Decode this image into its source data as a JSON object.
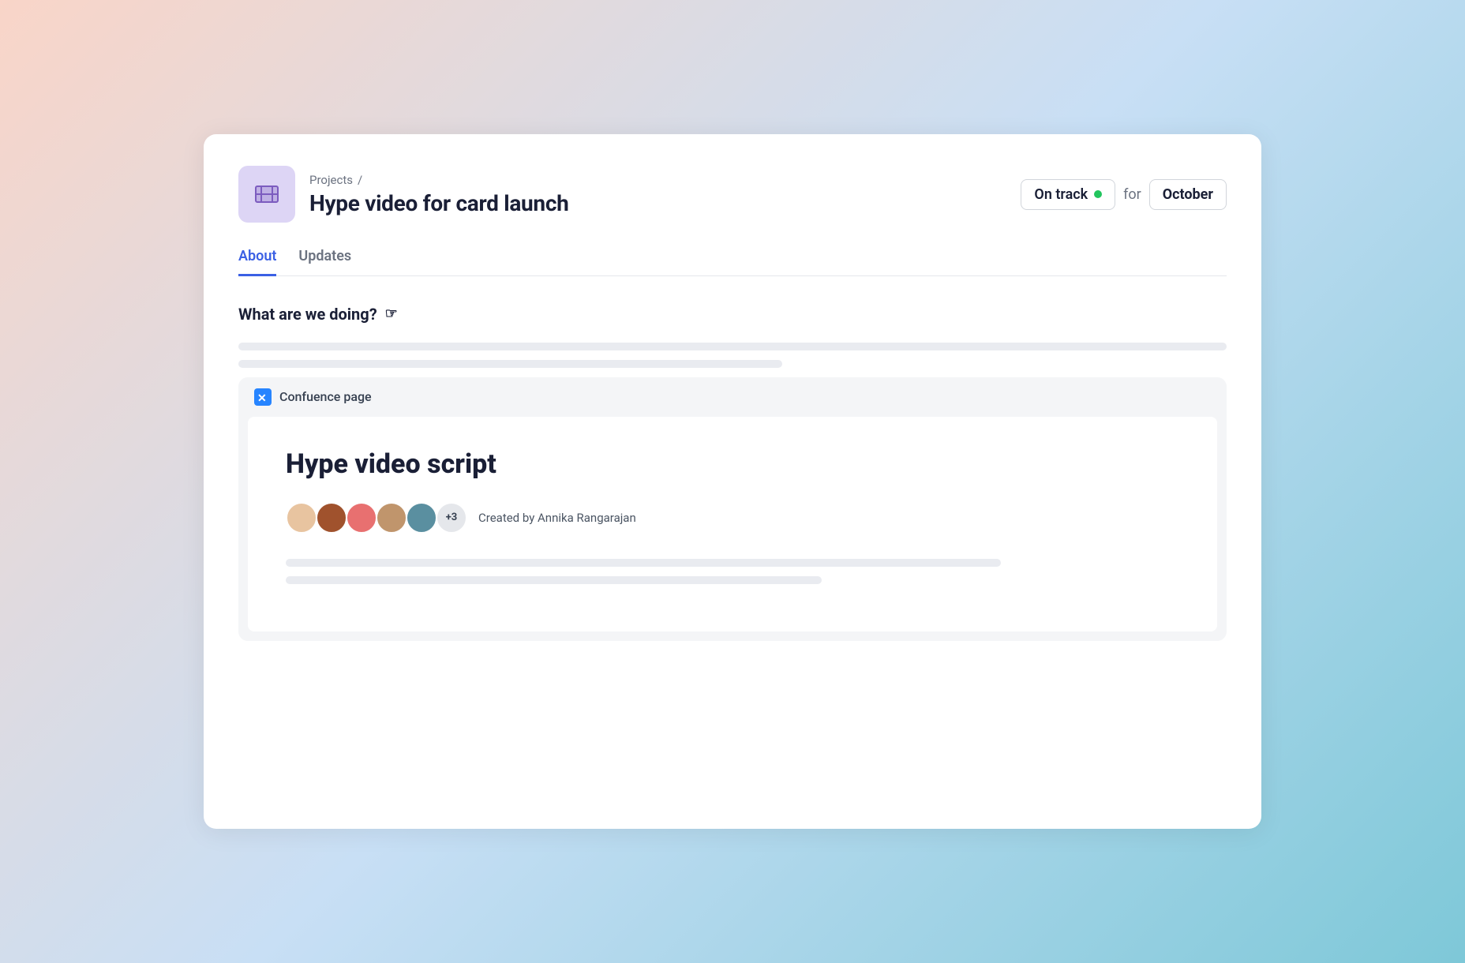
{
  "breadcrumb": {
    "parent": "Projects",
    "separator": "/"
  },
  "project": {
    "title": "Hype video for card launch"
  },
  "status": {
    "on_track_label": "On track",
    "for_label": "for",
    "month_label": "October"
  },
  "tabs": [
    {
      "id": "about",
      "label": "About",
      "active": true
    },
    {
      "id": "updates",
      "label": "Updates",
      "active": false
    }
  ],
  "section": {
    "title": "What are we doing?"
  },
  "confluence": {
    "label": "Confuence page",
    "doc_title": "Hype video script",
    "created_by": "Created by Annika Rangarajan",
    "avatar_plus": "+3"
  }
}
